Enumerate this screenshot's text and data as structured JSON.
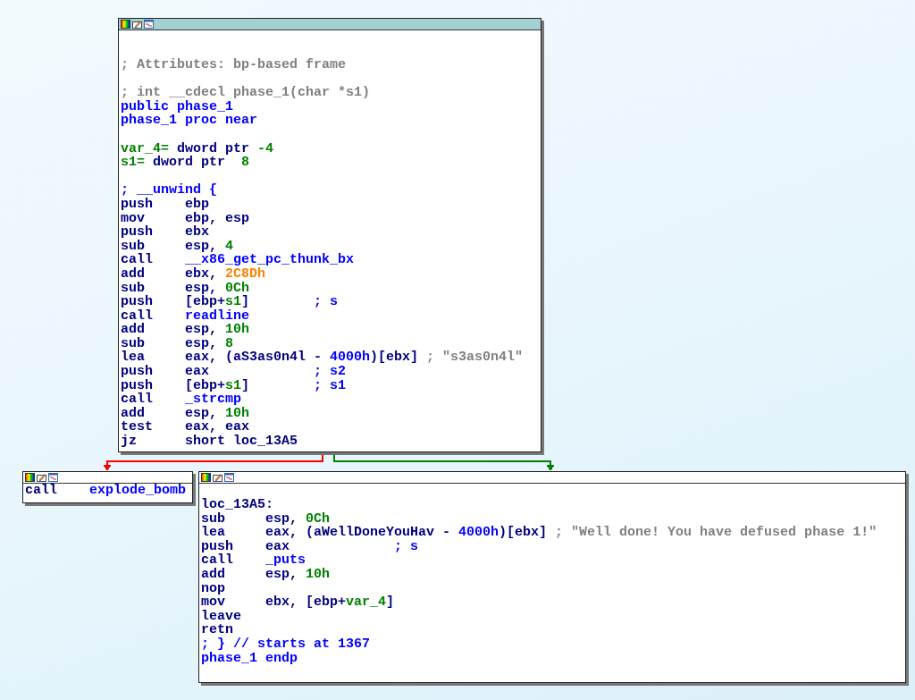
{
  "nodes": [
    {
      "kind": "entry",
      "blocks": [
        [
          [
            {
              "kind": "cmt",
              "text": "; Attributes: bp-based frame"
            }
          ]
        ],
        [
          [
            {
              "kind": "cmt",
              "text": "; int __cdecl phase_1(char *s1)"
            }
          ],
          [
            {
              "kind": "sym",
              "text": "public phase_1"
            }
          ],
          [
            {
              "kind": "sym",
              "text": "phase_1 proc near"
            }
          ]
        ],
        [
          [
            {
              "kind": "num",
              "text": "var_4="
            },
            {
              "kind": "ins",
              "text": " dword ptr "
            },
            {
              "kind": "num",
              "text": "-4"
            }
          ],
          [
            {
              "kind": "num",
              "text": "s1="
            },
            {
              "kind": "ins",
              "text": " dword ptr  "
            },
            {
              "kind": "num",
              "text": "8"
            }
          ]
        ],
        [
          [
            {
              "kind": "sym",
              "text": "; __unwind {"
            }
          ],
          [
            {
              "kind": "ins",
              "text": "push    ebp"
            }
          ],
          [
            {
              "kind": "ins",
              "text": "mov     ebp, esp"
            }
          ],
          [
            {
              "kind": "ins",
              "text": "push    ebx"
            }
          ],
          [
            {
              "kind": "ins",
              "text": "sub     esp, "
            },
            {
              "kind": "num",
              "text": "4"
            }
          ],
          [
            {
              "kind": "ins",
              "text": "call    "
            },
            {
              "kind": "sym",
              "text": "__x86_get_pc_thunk_bx"
            }
          ],
          [
            {
              "kind": "ins",
              "text": "add     ebx, "
            },
            {
              "kind": "imm",
              "text": "2C8Dh"
            }
          ],
          [
            {
              "kind": "ins",
              "text": "sub     esp, "
            },
            {
              "kind": "num",
              "text": "0Ch"
            }
          ],
          [
            {
              "kind": "ins",
              "text": "push    [ebp+"
            },
            {
              "kind": "num",
              "text": "s1"
            },
            {
              "kind": "ins",
              "text": "]        "
            },
            {
              "kind": "sym",
              "text": "; s"
            }
          ],
          [
            {
              "kind": "ins",
              "text": "call    "
            },
            {
              "kind": "sym",
              "text": "readline"
            }
          ],
          [
            {
              "kind": "ins",
              "text": "add     esp, "
            },
            {
              "kind": "num",
              "text": "10h"
            }
          ],
          [
            {
              "kind": "ins",
              "text": "sub     esp, "
            },
            {
              "kind": "num",
              "text": "8"
            }
          ],
          [
            {
              "kind": "ins",
              "text": "lea     eax, (aS3as0n4l - "
            },
            {
              "kind": "sym",
              "text": "4000h"
            },
            {
              "kind": "ins",
              "text": ")[ebx] "
            },
            {
              "kind": "cmt",
              "text": "; \"s3as0n4l\""
            }
          ],
          [
            {
              "kind": "ins",
              "text": "push    eax             "
            },
            {
              "kind": "sym",
              "text": "; s2"
            }
          ],
          [
            {
              "kind": "ins",
              "text": "push    [ebp+"
            },
            {
              "kind": "num",
              "text": "s1"
            },
            {
              "kind": "ins",
              "text": "]        "
            },
            {
              "kind": "sym",
              "text": "; s1"
            }
          ],
          [
            {
              "kind": "ins",
              "text": "call    "
            },
            {
              "kind": "sym",
              "text": "_strcmp"
            }
          ],
          [
            {
              "kind": "ins",
              "text": "add     esp, "
            },
            {
              "kind": "num",
              "text": "10h"
            }
          ],
          [
            {
              "kind": "ins",
              "text": "test    eax, eax"
            }
          ],
          [
            {
              "kind": "ins",
              "text": "jz      short loc_13A5"
            }
          ]
        ]
      ]
    },
    {
      "kind": "stub",
      "blocks": [
        [
          [
            {
              "kind": "ins",
              "text": "call    "
            },
            {
              "kind": "sym",
              "text": "explode_bomb"
            }
          ]
        ]
      ]
    },
    {
      "kind": "block",
      "blocks": [
        [
          [
            {
              "kind": "ins",
              "text": "loc_13A5:"
            }
          ],
          [
            {
              "kind": "ins",
              "text": "sub     esp, "
            },
            {
              "kind": "num",
              "text": "0Ch"
            }
          ],
          [
            {
              "kind": "ins",
              "text": "lea     eax, (aWellDoneYouHav - "
            },
            {
              "kind": "sym",
              "text": "4000h"
            },
            {
              "kind": "ins",
              "text": ")[ebx] "
            },
            {
              "kind": "cmt",
              "text": "; \"Well done! You have defused phase 1!\""
            }
          ],
          [
            {
              "kind": "ins",
              "text": "push    eax             "
            },
            {
              "kind": "sym",
              "text": "; s"
            }
          ],
          [
            {
              "kind": "ins",
              "text": "call    "
            },
            {
              "kind": "sym",
              "text": "_puts"
            }
          ],
          [
            {
              "kind": "ins",
              "text": "add     esp, "
            },
            {
              "kind": "num",
              "text": "10h"
            }
          ],
          [
            {
              "kind": "ins",
              "text": "nop"
            }
          ],
          [
            {
              "kind": "ins",
              "text": "mov     ebx, [ebp+"
            },
            {
              "kind": "num",
              "text": "var_4"
            },
            {
              "kind": "ins",
              "text": "]"
            }
          ],
          [
            {
              "kind": "ins",
              "text": "leave"
            }
          ],
          [
            {
              "kind": "ins",
              "text": "retn"
            }
          ],
          [
            {
              "kind": "sym",
              "text": "; } // starts at 1367"
            }
          ],
          [
            {
              "kind": "sym",
              "text": "phase_1 endp"
            }
          ]
        ]
      ]
    }
  ],
  "edges": [
    {
      "color": "#ff0000"
    },
    {
      "color": "#008000"
    }
  ]
}
